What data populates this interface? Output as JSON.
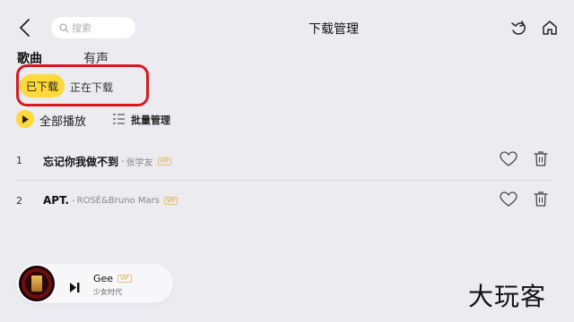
{
  "header": {
    "title": "下载管理",
    "search_placeholder": "搜索"
  },
  "category_tabs": [
    {
      "label": "歌曲",
      "active": true
    },
    {
      "label": "有声",
      "active": false
    }
  ],
  "sub_tabs": [
    {
      "label": "已下载",
      "active": true
    },
    {
      "label": "正在下载",
      "active": false
    }
  ],
  "actions": {
    "play_all": "全部播放",
    "batch_manage": "批量管理"
  },
  "songs": [
    {
      "index": "1",
      "title": "忘记你我做不到",
      "separator": "-",
      "artist": "张学友",
      "badge": "VIP"
    },
    {
      "index": "2",
      "title": "APT.",
      "separator": "-",
      "artist": "ROSÉ&Bruno Mars",
      "badge": "VIP"
    }
  ],
  "player": {
    "title": "Gee",
    "badge": "VIP",
    "artist": "少女时代"
  },
  "watermark": "大玩客",
  "colors": {
    "background": "#ebebf0",
    "accent": "#ffd939",
    "highlight_border": "#d6191f",
    "vip": "#d1a64e"
  }
}
